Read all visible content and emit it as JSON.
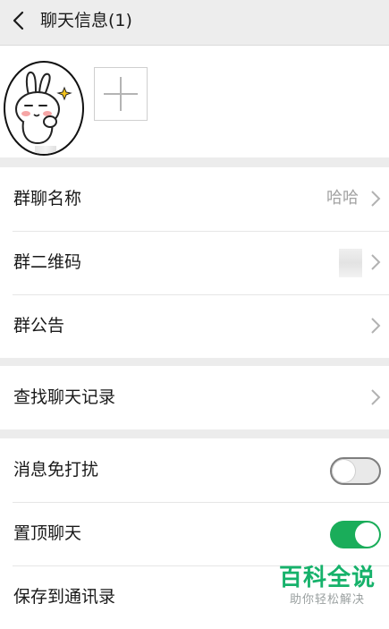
{
  "header": {
    "title": "聊天信息(1)",
    "back_icon": "chevron-left-icon"
  },
  "members": {
    "add_icon": "plus-icon"
  },
  "section1": {
    "group_name": {
      "label": "群聊名称",
      "value": "哈哈"
    },
    "qr_code": {
      "label": "群二维码"
    },
    "announcement": {
      "label": "群公告"
    }
  },
  "section2": {
    "search_history": {
      "label": "查找聊天记录"
    }
  },
  "section3": {
    "mute": {
      "label": "消息免打扰",
      "on": false
    },
    "sticky": {
      "label": "置顶聊天",
      "on": true
    },
    "save_contacts": {
      "label": "保存到通讯录"
    }
  },
  "watermark": {
    "main": "百科全说",
    "sub": "助你轻松解决"
  },
  "colors": {
    "accent_green": "#1aad5a",
    "watermark_green": "#16b26b"
  }
}
